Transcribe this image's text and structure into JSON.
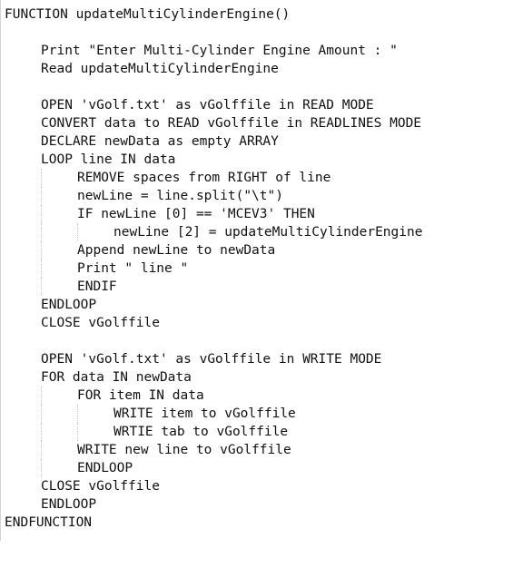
{
  "code": {
    "lines": [
      "FUNCTION updateMultiCylinderEngine()",
      "",
      "Print \"Enter Multi-Cylinder Engine Amount : \"",
      "Read updateMultiCylinderEngine",
      "",
      "OPEN 'vGolf.txt' as vGolffile in READ MODE",
      "CONVERT data to READ vGolffile in READLINES MODE",
      "DECLARE newData as empty ARRAY",
      "LOOP line IN data",
      "REMOVE spaces from RIGHT of line",
      "newLine = line.split(\"\\t\")",
      "IF newLine [0] == 'MCEV3' THEN",
      "newLine [2] = updateMultiCylinderEngine",
      "Append newLine to newData",
      "Print \" line \"",
      "ENDIF",
      "ENDLOOP",
      "CLOSE vGolffile",
      "",
      "OPEN 'vGolf.txt' as vGolffile in WRITE MODE",
      "FOR data IN newData",
      "FOR item IN data",
      "WRITE item to vGolffile",
      "WRTIE tab to vGolffile",
      "WRITE new line to vGolffile",
      "ENDLOOP",
      "CLOSE vGolffile",
      "ENDLOOP",
      "ENDFUNCTION"
    ]
  }
}
